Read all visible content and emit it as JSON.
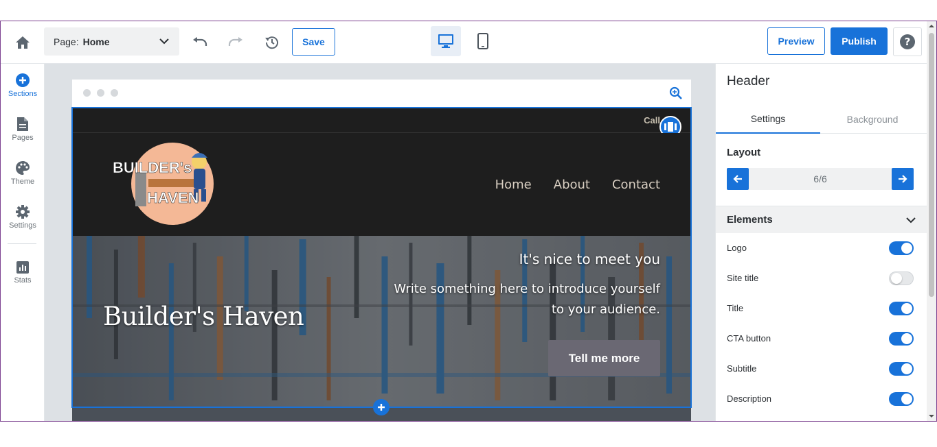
{
  "toolbar": {
    "page_label": "Page:",
    "page_value": "Home",
    "save_label": "Save",
    "preview_label": "Preview",
    "publish_label": "Publish",
    "icons": [
      "home-icon",
      "undo-icon",
      "redo-icon",
      "history-icon",
      "desktop-icon",
      "mobile-icon",
      "help-icon"
    ]
  },
  "leftnav": {
    "items": [
      {
        "label": "Sections",
        "icon": "plus-circle-icon",
        "active": true
      },
      {
        "label": "Pages",
        "icon": "page-icon",
        "active": false
      },
      {
        "label": "Theme",
        "icon": "palette-icon",
        "active": false
      },
      {
        "label": "Settings",
        "icon": "gear-icon",
        "active": false
      },
      {
        "label": "Stats",
        "icon": "bar-chart-icon",
        "active": false
      }
    ]
  },
  "site": {
    "call_label": "Call",
    "logo_text_1": "BUILDER's",
    "logo_text_2": "HAVEN",
    "menu": [
      "Home",
      "About",
      "Contact"
    ],
    "hero_title": "Builder's Haven",
    "hero_subtitle": "It's nice to meet you",
    "hero_description": "Write something here to introduce yourself to your audience.",
    "cta_label": "Tell me more"
  },
  "panel": {
    "title": "Header",
    "tabs": [
      "Settings",
      "Background"
    ],
    "layout_label": "Layout",
    "layout_value": "6/6",
    "elements_label": "Elements",
    "elements": [
      {
        "name": "Logo",
        "enabled": true
      },
      {
        "name": "Site title",
        "enabled": false
      },
      {
        "name": "Title",
        "enabled": true
      },
      {
        "name": "CTA button",
        "enabled": true
      },
      {
        "name": "Subtitle",
        "enabled": true
      },
      {
        "name": "Description",
        "enabled": true
      }
    ]
  },
  "colors": {
    "accent": "#1872d9",
    "header_bg": "#1e1e1e",
    "cta_bg": "#6a6873",
    "canvas_bg": "#dde1e5"
  }
}
